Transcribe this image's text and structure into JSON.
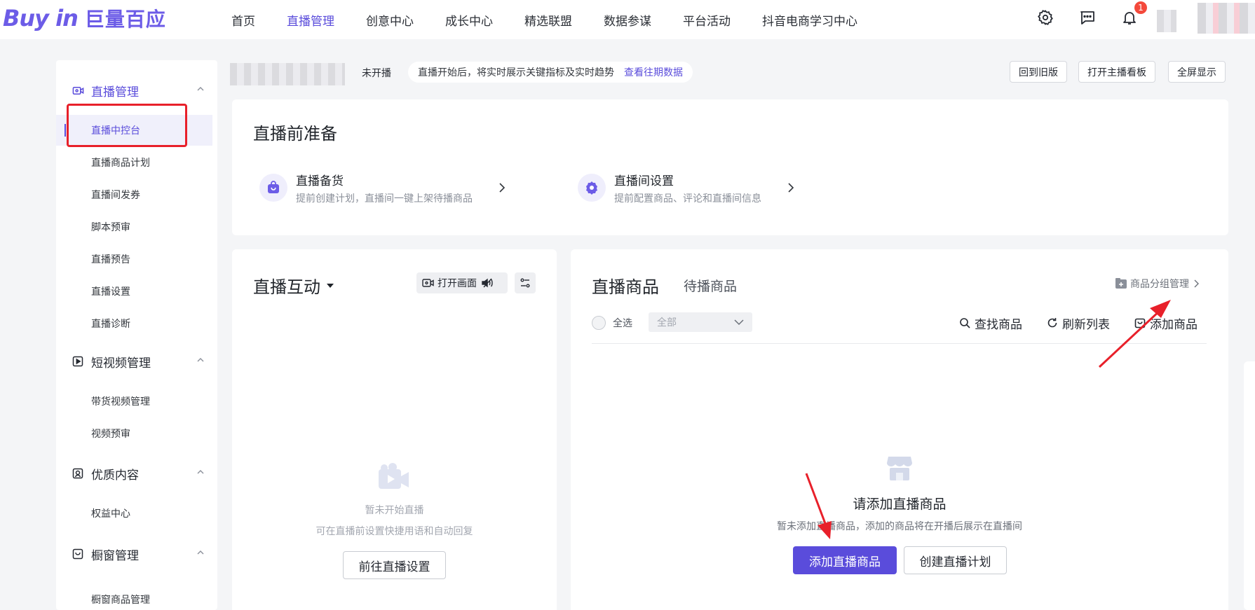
{
  "logo": {
    "wordmark": "Buy in",
    "brand": "巨量百应"
  },
  "nav": {
    "items": [
      {
        "label": "首页",
        "active": false
      },
      {
        "label": "直播管理",
        "active": true
      },
      {
        "label": "创意中心",
        "active": false
      },
      {
        "label": "成长中心",
        "active": false
      },
      {
        "label": "精选联盟",
        "active": false
      },
      {
        "label": "数据参谋",
        "active": false
      },
      {
        "label": "平台活动",
        "active": false
      },
      {
        "label": "抖音电商学习中心",
        "active": false
      }
    ],
    "notification_count": "1"
  },
  "sidebar": {
    "groups": [
      {
        "label": "直播管理",
        "icon": "live-camera-icon",
        "open": true,
        "items": [
          "直播中控台",
          "直播商品计划",
          "直播间发券",
          "脚本预审",
          "直播预告",
          "直播设置",
          "直播诊断"
        ],
        "active": "直播中控台"
      },
      {
        "label": "短视频管理",
        "icon": "play-square-icon",
        "open": true,
        "items": [
          "带货视频管理",
          "视频预审"
        ]
      },
      {
        "label": "优质内容",
        "icon": "content-icon",
        "open": true,
        "items": [
          "权益中心"
        ]
      },
      {
        "label": "橱窗管理",
        "icon": "window-shop-icon",
        "open": true,
        "items": [
          "橱窗商品管理"
        ]
      }
    ]
  },
  "header": {
    "status": "未开播",
    "tip": "直播开始后，将实时展示关键指标及实时趋势",
    "tip_link": "查看往期数据",
    "buttons": [
      "回到旧版",
      "打开主播看板",
      "全屏显示"
    ]
  },
  "prep": {
    "title": "直播前准备",
    "items": [
      {
        "title": "直播备货",
        "desc": "提前创建计划，直播间一键上架待播商品",
        "icon": "shopping-bag-icon"
      },
      {
        "title": "直播间设置",
        "desc": "提前配置商品、评论和直播间信息",
        "icon": "settings-gear-icon"
      }
    ]
  },
  "interaction": {
    "title": "直播互动",
    "open_screen": "打开画面",
    "empty_title": "暂未开始直播",
    "empty_desc": "可在直播前设置快捷用语和自动回复",
    "button": "前往直播设置"
  },
  "products": {
    "tab_active": "直播商品",
    "tab_other": "待播商品",
    "group_manage": "商品分组管理",
    "select_all": "全选",
    "filter_value": "全部",
    "tools": [
      "查找商品",
      "刷新列表",
      "添加商品"
    ],
    "empty_title": "请添加直播商品",
    "empty_desc": "暂未添加直播商品，添加的商品将在开播后展示在直播间",
    "primary_button": "添加直播商品",
    "secondary_button": "创建直播计划"
  },
  "colors": {
    "accent": "#5a4cdb",
    "annotation_red": "#e8202a"
  }
}
